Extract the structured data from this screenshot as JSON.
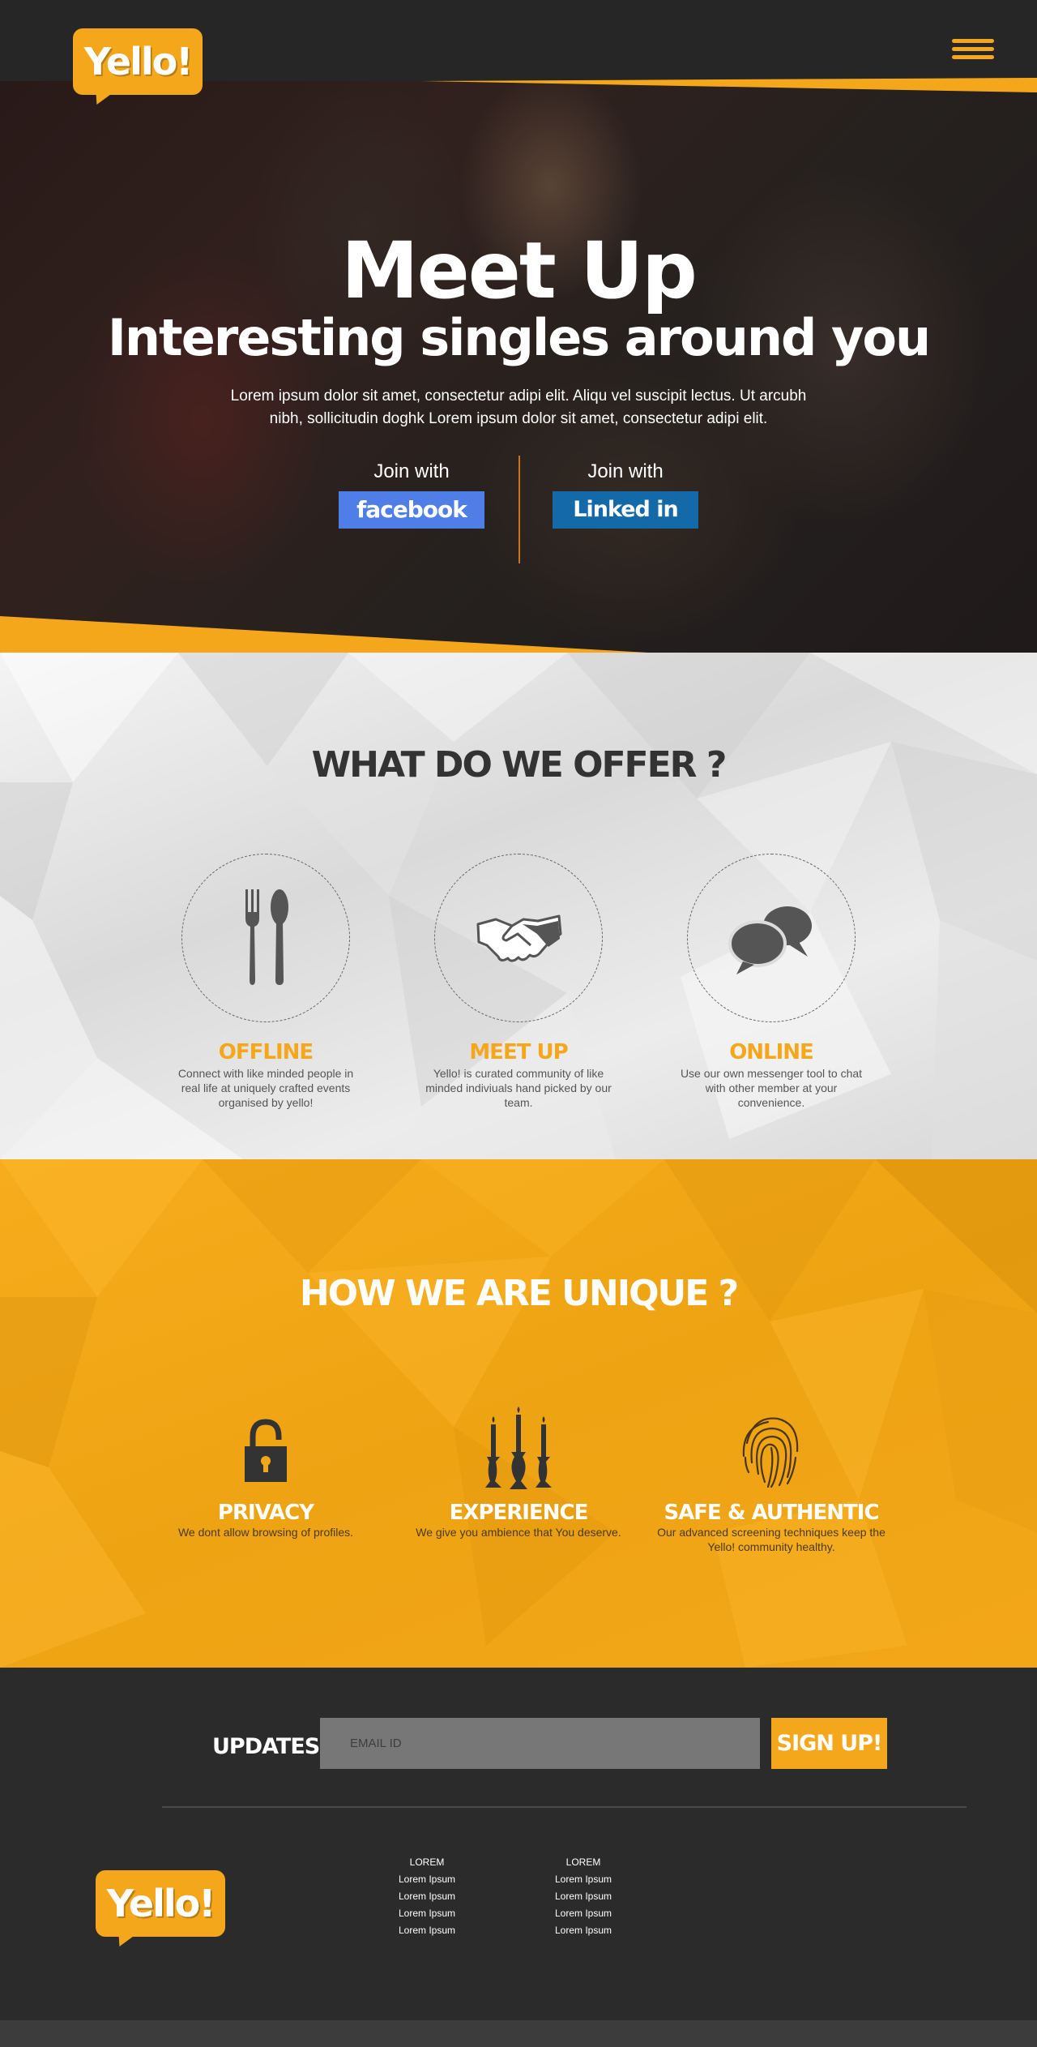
{
  "header": {
    "logo": "Yello!",
    "menu_icon": "hamburger-menu-icon"
  },
  "hero": {
    "title": "Meet Up",
    "subtitle": "Interesting singles around you",
    "text": "Lorem ipsum dolor sit amet, consectetur adipi elit. Aliqu vel suscipit lectus. Ut arcubh nibh, sollicitudin doghk Lorem ipsum dolor sit amet, consectetur adipi elit.",
    "join": [
      {
        "label": "Join with",
        "button": "facebook"
      },
      {
        "label": "Join with",
        "button": "Linked in"
      }
    ]
  },
  "offer": {
    "title": "WHAT DO WE OFFER ?",
    "items": [
      {
        "icon": "fork-spoon-icon",
        "name": "OFFLINE",
        "desc": "Connect with like minded people in real life at uniquely crafted events organised by yello!"
      },
      {
        "icon": "handshake-icon",
        "name": "MEET UP",
        "desc": "Yello! is curated community of like minded indiviuals hand picked by our team."
      },
      {
        "icon": "chat-bubbles-icon",
        "name": "ONLINE",
        "desc": "Use our own messenger tool to chat with other member at your convenience."
      }
    ]
  },
  "unique": {
    "title": "HOW WE ARE UNIQUE ?",
    "items": [
      {
        "icon": "padlock-icon",
        "name": "PRIVACY",
        "desc": "We dont allow browsing of profiles."
      },
      {
        "icon": "candles-icon",
        "name": "EXPERIENCE",
        "desc": "We give you ambience that You deserve."
      },
      {
        "icon": "fingerprint-icon",
        "name": "SAFE & AUTHENTIC",
        "desc": "Our advanced screening techniques keep the Yello! community healthy."
      }
    ]
  },
  "footer": {
    "updates_label": "UPDATES",
    "email_placeholder": "EMAIL ID",
    "signup_label": "SIGN UP!",
    "logo": "Yello!",
    "columns": [
      {
        "heading": "LOREM",
        "links": [
          "Lorem Ipsum",
          "Lorem Ipsum",
          "Lorem Ipsum",
          "Lorem Ipsum"
        ]
      },
      {
        "heading": "LOREM",
        "links": [
          "Lorem Ipsum",
          "Lorem Ipsum",
          "Lorem Ipsum",
          "Lorem Ipsum"
        ]
      }
    ]
  },
  "colors": {
    "accent": "#f5a71c",
    "dark": "#2b2b2b",
    "facebook": "#4f7fe6",
    "linkedin": "#1469a8"
  }
}
